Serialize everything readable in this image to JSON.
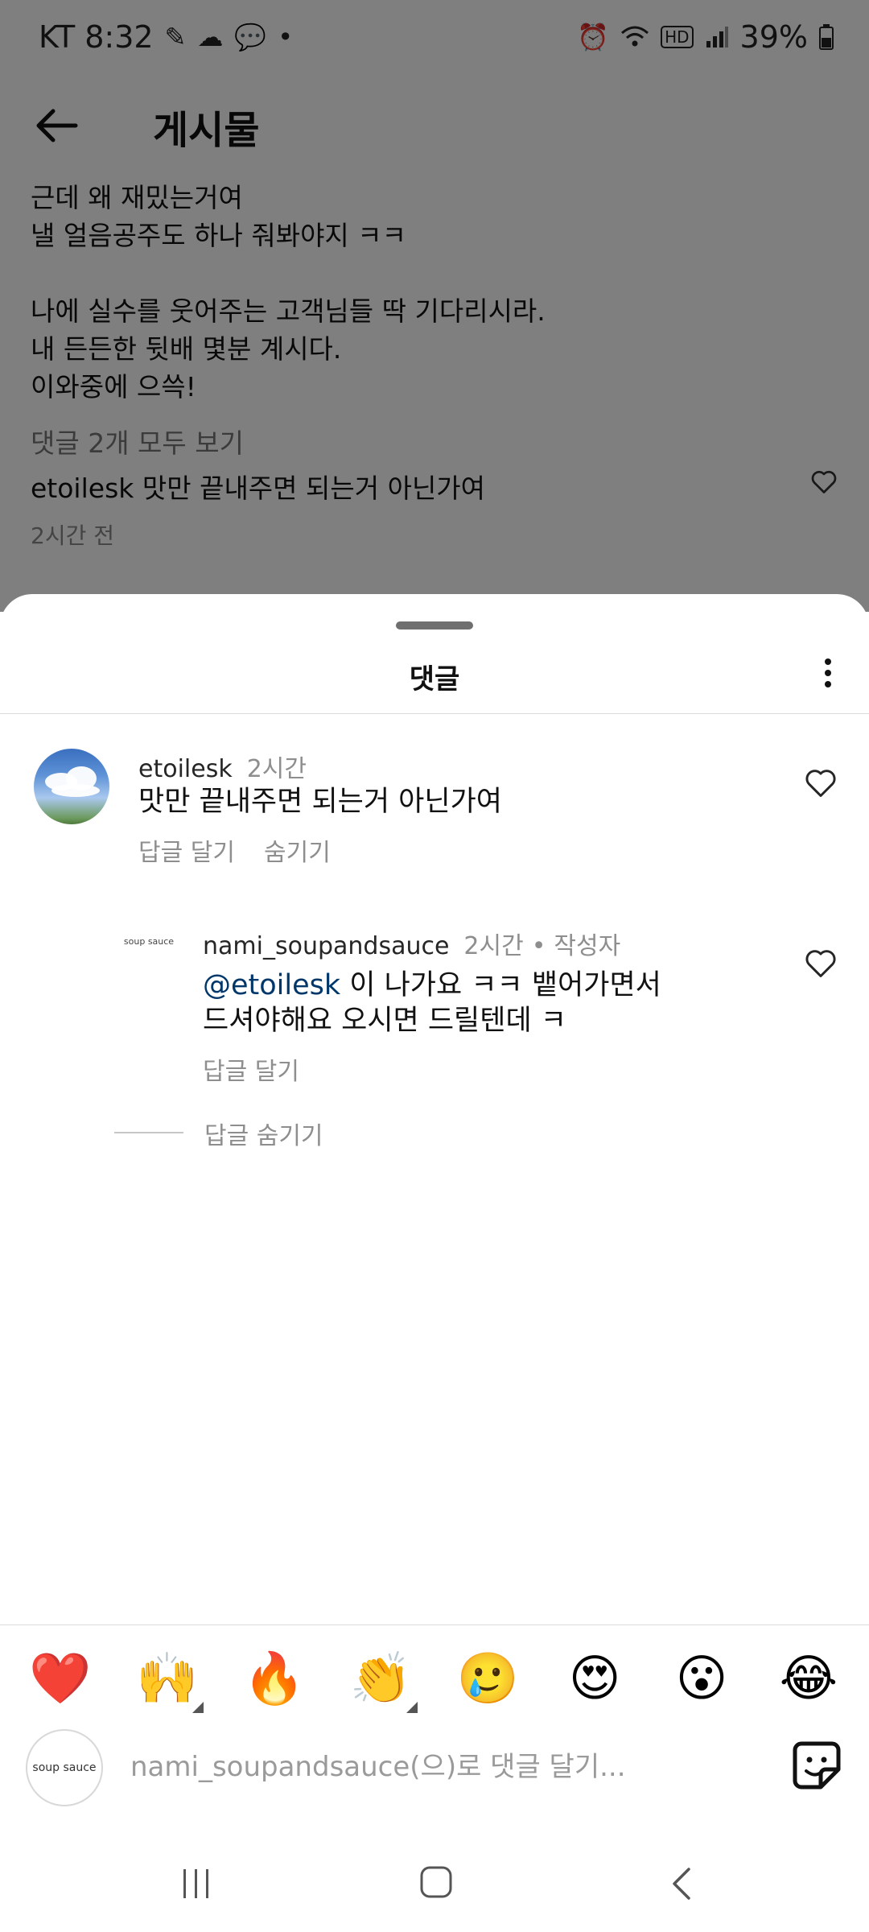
{
  "status_bar": {
    "carrier_time": "KT 8:32",
    "battery": "39%",
    "hd": "HD"
  },
  "post": {
    "title": "게시물",
    "caption_lines": [
      "근데 왜 재밌는거여",
      "낼 얼음공주도 하나 줘봐야지 ㅋㅋ",
      "",
      "나에 실수를 웃어주는 고객님들 딱 기다리시라.",
      "내 든든한 뒷배 몇분 계시다.",
      "이와중에 으쓱!"
    ],
    "view_all_comments": "댓글 2개 모두 보기",
    "preview_user": "etoilesk",
    "preview_text": "맛만 끝내주면 되는거 아닌가여",
    "time": "2시간 전"
  },
  "sheet": {
    "title": "댓글"
  },
  "comments": [
    {
      "username": "etoilesk",
      "time": "2시간",
      "text": "맛만 끝내주면 되는거 아닌가여",
      "reply_label": "답글 달기",
      "hide_label": "숨기기"
    },
    {
      "username": "nami_soupandsauce",
      "time": "2시간",
      "author_badge": "작성자",
      "mention": "@etoilesk",
      "text_line1": " 이 나가요 ㅋㅋ 뱉어가면서",
      "text_line2": "드셔야해요 오시면 드릴텐데 ㅋ",
      "reply_label": "답글 달기",
      "logo_text": "soup sauce"
    }
  ],
  "hide_replies_label": "답글 숨기기",
  "emoji_bar": [
    "❤️",
    "🙌",
    "🔥",
    "👏",
    "🥲",
    "😍",
    "😮",
    "😂"
  ],
  "composer": {
    "placeholder": "nami_soupandsauce(으)로 댓글 달기...",
    "avatar_text": "soup sauce"
  },
  "colors": {
    "mention": "#00376b",
    "secondary_text": "#8e8e8e",
    "scrim": "rgba(0,0,0,0.5)"
  }
}
